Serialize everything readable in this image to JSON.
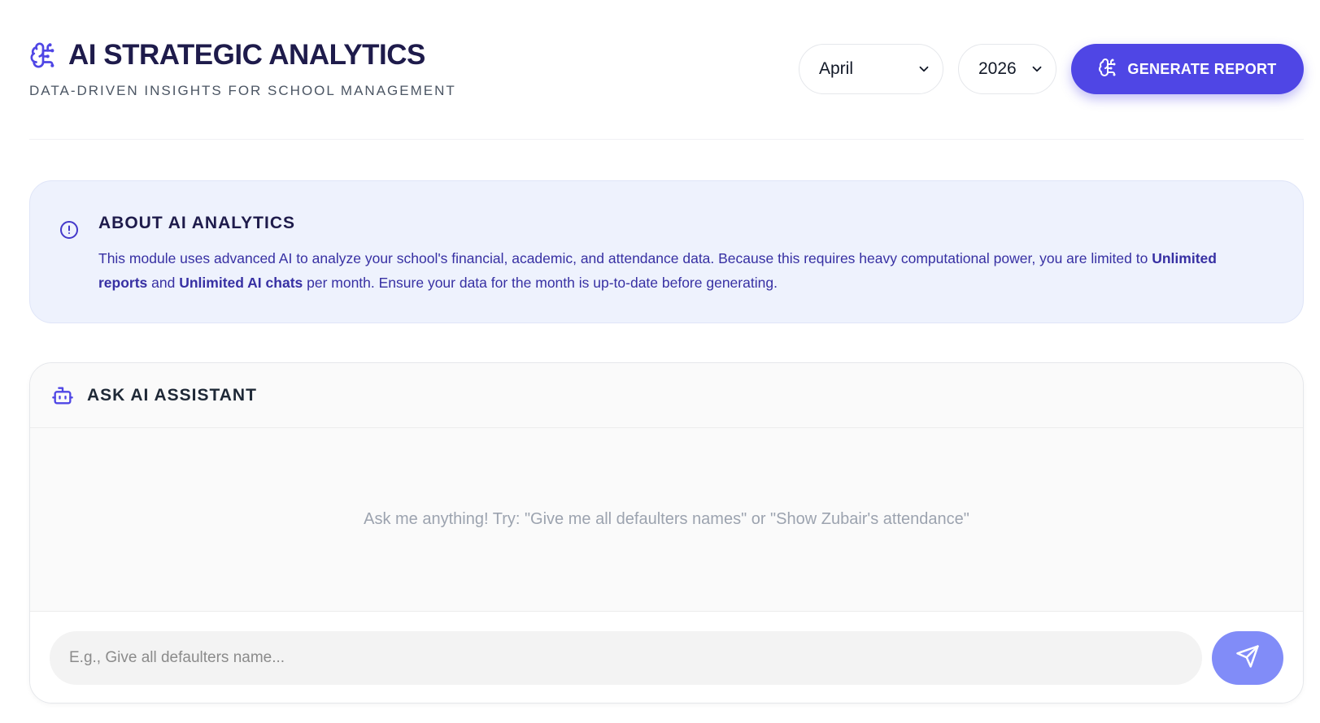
{
  "header": {
    "title": "AI STRATEGIC ANALYTICS",
    "subtitle": "DATA-DRIVEN INSIGHTS FOR SCHOOL MANAGEMENT",
    "title_icon": "brain-circuit-icon"
  },
  "controls": {
    "month": "April",
    "year": "2026",
    "generate_label": "GENERATE REPORT",
    "generate_icon": "brain-circuit-icon"
  },
  "about": {
    "icon": "info-circle-icon",
    "title": "ABOUT AI ANALYTICS",
    "text_1": "This module uses advanced AI to analyze your school's financial, academic, and attendance data. Because this requires heavy computational power, you are limited to ",
    "bold_1": "Unlimited reports",
    "text_2": " and ",
    "bold_2": "Unlimited AI chats",
    "text_3": " per month. Ensure your data for the month is up-to-date before generating."
  },
  "assistant": {
    "icon": "bot-icon",
    "title": "ASK AI ASSISTANT",
    "hint": "Ask me anything! Try: \"Give me all defaulters names\" or \"Show Zubair's attendance\"",
    "input_value": "",
    "input_placeholder": "E.g., Give all defaulters name...",
    "send_icon": "send-icon"
  },
  "colors": {
    "accent": "#4f46e5",
    "send_button": "#818cf8",
    "info_bg": "#eef2fd",
    "title_text": "#1e1b4b"
  }
}
